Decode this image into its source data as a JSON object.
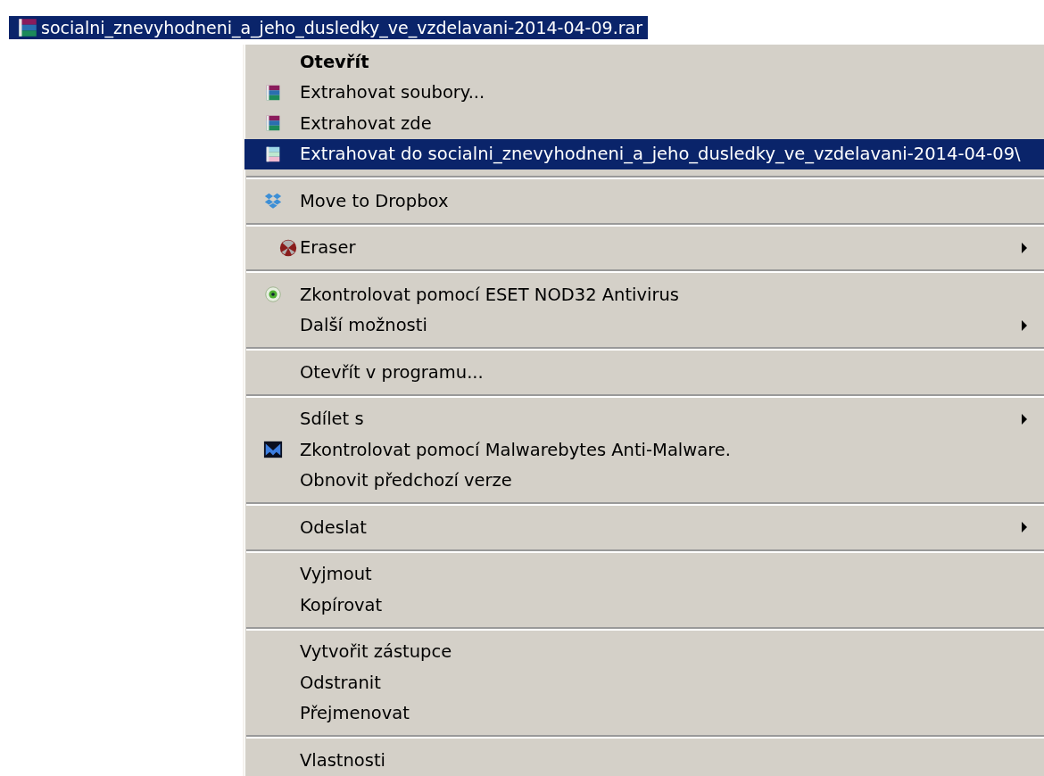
{
  "file": {
    "name": "socialni_znevyhodneni_a_jeho_dusledky_ve_vzdelavani-2014-04-09.rar",
    "selected": true
  },
  "menu": {
    "groups": [
      {
        "items": [
          {
            "label": "Otevřít",
            "kind": "plain",
            "bold": true,
            "submenu": false,
            "selected": false
          },
          {
            "label": "Extrahovat soubory...",
            "kind": "archive",
            "bold": false,
            "submenu": false,
            "selected": false
          },
          {
            "label": "Extrahovat zde",
            "kind": "archive",
            "bold": false,
            "submenu": false,
            "selected": false
          },
          {
            "label": "Extrahovat do socialni_znevyhodneni_a_jeho_dusledky_ve_vzdelavani-2014-04-09\\",
            "kind": "archive",
            "bold": false,
            "submenu": false,
            "selected": true
          }
        ]
      },
      {
        "items": [
          {
            "label": "Move to Dropbox",
            "kind": "dropbox",
            "bold": false,
            "submenu": false,
            "selected": false
          }
        ]
      },
      {
        "items": [
          {
            "label": "Eraser",
            "kind": "eraser",
            "bold": false,
            "submenu": true,
            "selected": false
          }
        ]
      },
      {
        "items": [
          {
            "label": "Zkontrolovat pomocí ESET NOD32 Antivirus",
            "kind": "eset",
            "bold": false,
            "submenu": false,
            "selected": false
          },
          {
            "label": "Další možnosti",
            "kind": "plain",
            "bold": false,
            "submenu": true,
            "selected": false
          }
        ]
      },
      {
        "items": [
          {
            "label": "Otevřít v programu...",
            "kind": "plain",
            "bold": false,
            "submenu": false,
            "selected": false
          }
        ]
      },
      {
        "items": [
          {
            "label": "Sdílet s",
            "kind": "plain",
            "bold": false,
            "submenu": true,
            "selected": false
          },
          {
            "label": "Zkontrolovat pomocí Malwarebytes Anti-Malware.",
            "kind": "malwarebytes",
            "bold": false,
            "submenu": false,
            "selected": false
          },
          {
            "label": "Obnovit předchozí verze",
            "kind": "plain",
            "bold": false,
            "submenu": false,
            "selected": false
          }
        ]
      },
      {
        "items": [
          {
            "label": "Odeslat",
            "kind": "plain",
            "bold": false,
            "submenu": true,
            "selected": false
          }
        ]
      },
      {
        "items": [
          {
            "label": "Vyjmout",
            "kind": "plain",
            "bold": false,
            "submenu": false,
            "selected": false
          },
          {
            "label": "Kopírovat",
            "kind": "plain",
            "bold": false,
            "submenu": false,
            "selected": false
          }
        ]
      },
      {
        "items": [
          {
            "label": "Vytvořit zástupce",
            "kind": "plain",
            "bold": false,
            "submenu": false,
            "selected": false
          },
          {
            "label": "Odstranit",
            "kind": "plain",
            "bold": false,
            "submenu": false,
            "selected": false
          },
          {
            "label": "Přejmenovat",
            "kind": "plain",
            "bold": false,
            "submenu": false,
            "selected": false
          }
        ]
      },
      {
        "items": [
          {
            "label": "Vlastnosti",
            "kind": "plain",
            "bold": false,
            "submenu": false,
            "selected": false
          }
        ]
      }
    ]
  }
}
